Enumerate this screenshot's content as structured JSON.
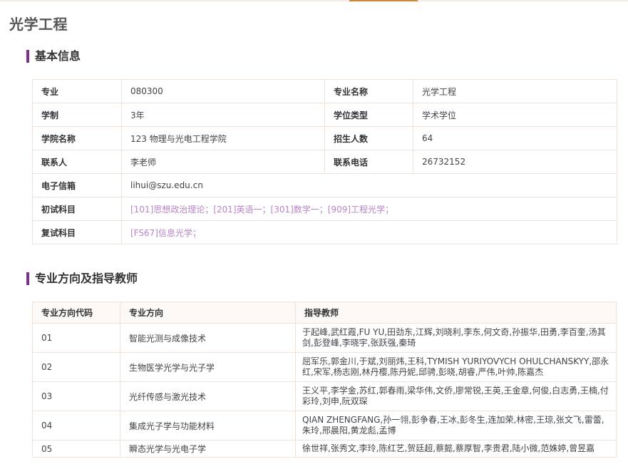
{
  "page_title": "光学工程",
  "basic": {
    "heading": "基本信息",
    "rows": [
      {
        "l1": "专业",
        "v1": "080300",
        "l2": "专业名称",
        "v2": "光学工程"
      },
      {
        "l1": "学制",
        "v1": "3年",
        "l2": "学位类型",
        "v2": "学术学位"
      },
      {
        "l1": "学院名称",
        "v1": "123 物理与光电工程学院",
        "l2": "招生人数",
        "v2": "64"
      },
      {
        "l1": "联系人",
        "v1": "李老师",
        "l2": "联系电话",
        "v2": "26732152"
      }
    ],
    "email_label": "电子信箱",
    "email": "lihui@szu.edu.cn",
    "exam1_label": "初试科目",
    "exam1": "[101]思想政治理论；[201]英语一；[301]数学一；[909]工程光学；",
    "exam2_label": "复试科目",
    "exam2": "[FS67]信息光学；",
    "link_color": "#b885c6"
  },
  "directions": {
    "heading": "专业方向及指导教师",
    "headers": [
      "专业方向代码",
      "专业方向",
      "指导教师"
    ],
    "rows": [
      {
        "code": "01",
        "name": "智能光测与成像技术",
        "teachers": "于起峰,武红霞,FU YU,田劲东,江辉,刘晓利,李东,何文奇,孙振华,田勇,李百奎,汤其剑,彭登峰,李晓宇,张跃强,秦琦"
      },
      {
        "code": "02",
        "name": "生物医学光学与光子学",
        "teachers": "屈军乐,郭金川,于斌,刘丽炜,王科,TYMISH YURIYOVYCH OHULCHANSKYY,邵永红,宋军,杨志刚,林丹樱,陈丹妮,邱骋,彭晓,胡睿,严伟,叶帅,陈嘉杰"
      },
      {
        "code": "03",
        "name": "光纤传感与激光技术",
        "teachers": "王义平,李学金,苏红,郭春雨,梁华伟,文侨,廖常锐,王英,王金章,何俊,白志勇,王楠,付彩玲,刘申,阮双琛"
      },
      {
        "code": "04",
        "name": "集成光子学与功能材料",
        "teachers": "QIAN ZHENGFANG,孙一翎,彭争春,王冰,彭冬生,连加荣,林密,王琼,张文飞,雷蕾,朱玲,邢晨阳,黄龙彪,孟博"
      },
      {
        "code": "05",
        "name": "瞬态光学与光电子学",
        "teachers": "徐世祥,张秀文,李玲,陈红艺,贺廷超,蔡懿,蔡厚智,李贵君,陆小微,范姝婷,曾昱嘉"
      }
    ]
  },
  "colors": {
    "accent_bar": "#7b2f8e",
    "top_tab": "#c98a3c",
    "border": "#f0e2d6"
  }
}
